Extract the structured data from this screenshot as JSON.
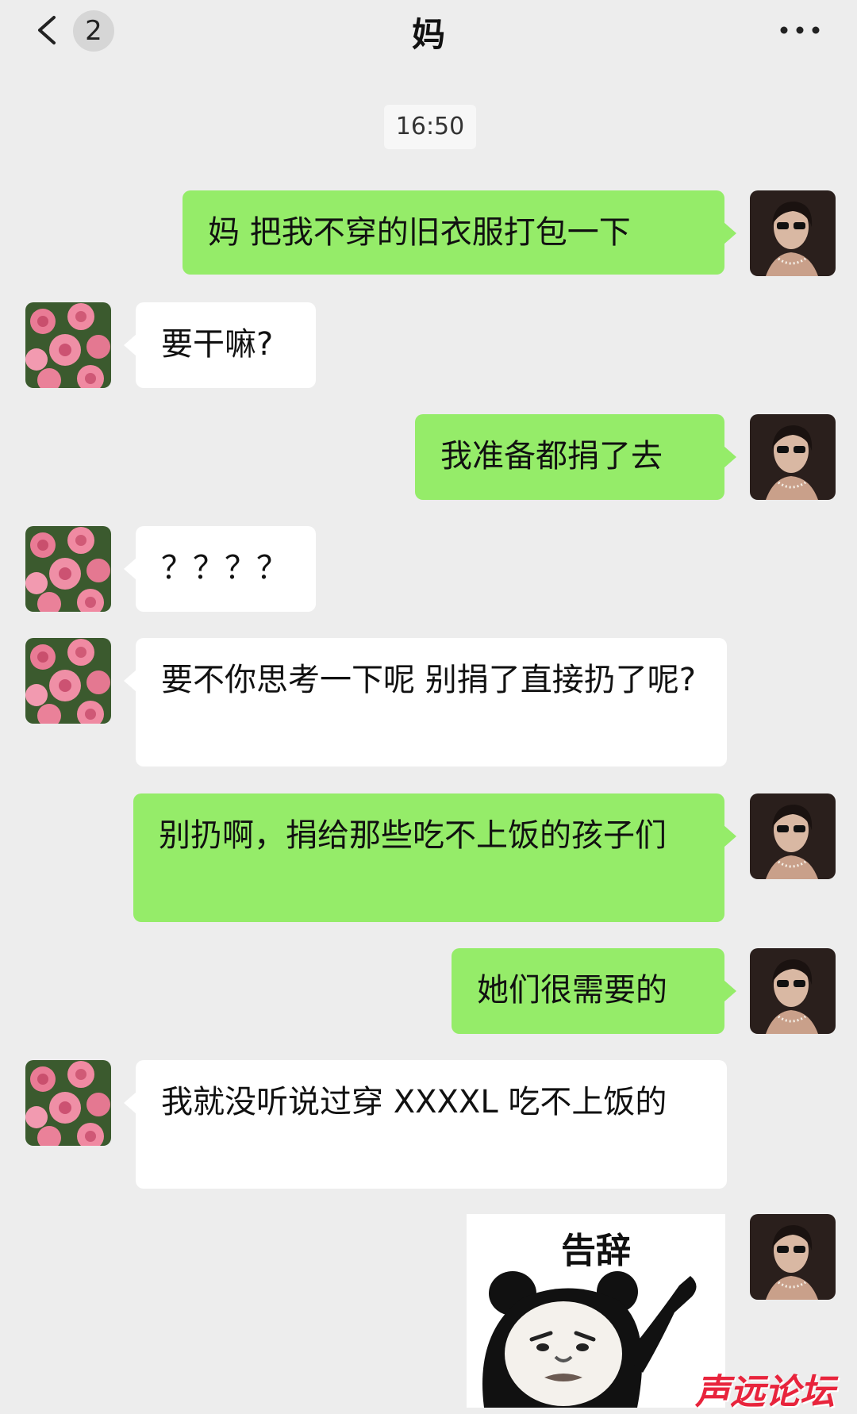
{
  "header": {
    "back_icon": "chevron-left-icon",
    "unread_count": "2",
    "title": "妈",
    "more_icon": "ellipsis-icon"
  },
  "timestamp": "16:50",
  "messages": [
    {
      "from": "me",
      "text": "妈 把我不穿的旧衣服打包一下"
    },
    {
      "from": "mom",
      "text": "要干嘛?"
    },
    {
      "from": "me",
      "text": "我准备都捐了去"
    },
    {
      "from": "mom",
      "text": "？？？？"
    },
    {
      "from": "mom",
      "text": "要不你思考一下呢  别捐了直接扔了呢?"
    },
    {
      "from": "me",
      "text": "别扔啊，捐给那些吃不上饭的孩子们"
    },
    {
      "from": "me",
      "text": "她们很需要的"
    },
    {
      "from": "mom",
      "text": "我就没听说过穿 XXXXL 吃不上饭的"
    },
    {
      "from": "me",
      "type": "sticker",
      "caption": "告辞",
      "image": "panda-meme-sticker"
    }
  ],
  "watermark": "声远论坛",
  "colors": {
    "background": "#ededed",
    "outgoing_bubble": "#95ec69",
    "incoming_bubble": "#ffffff"
  }
}
